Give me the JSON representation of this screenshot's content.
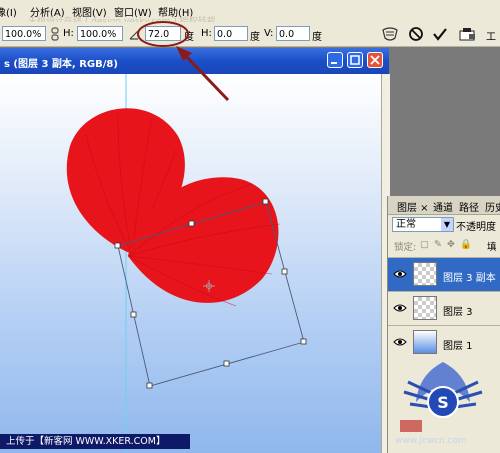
{
  "menubar": {
    "items": [
      "像(I)",
      "分析(A)",
      "视图(V)",
      "窗口(W)",
      "帮助(H)"
    ],
    "watermark": "天极设计在线 ( design.yesky.com ) 授权转载"
  },
  "options": {
    "w_value": "100.0%",
    "h_label": "H:",
    "h_value": "100.0%",
    "angle_value": "72.0",
    "angle_unit": "度",
    "skew_h_label": "H:",
    "skew_h_value": "0.0",
    "skew_unit_h": "度",
    "skew_v_label": "V:",
    "skew_v_value": "0.0",
    "skew_unit_v": "度",
    "extra_label": "工"
  },
  "document": {
    "title": "s (图层 3 副本, RGB/8)"
  },
  "layers_panel": {
    "tabs": [
      "图层 ×",
      "通道",
      "路径",
      "历史"
    ],
    "blend_mode": "正常",
    "opacity_label": "不透明度",
    "lock_label": "锁定:",
    "fill_label": "填",
    "layers": [
      {
        "name": "图层 3 副本",
        "selected": true,
        "thumb": "checker"
      },
      {
        "name": "图层 3",
        "selected": false,
        "thumb": "checker"
      },
      {
        "name": "图层 1",
        "selected": false,
        "thumb": "gradient"
      }
    ]
  },
  "footer": {
    "upload_text": "上传于【新客网 WWW.XKER.COM】",
    "site_mark": "www.jcwcn.com"
  },
  "colors": {
    "petal": "#e8141c",
    "canvas_top": "#ffffff",
    "canvas_bottom": "#8fb7ec",
    "title_bar": "#1a4fc8",
    "selected_layer": "#316ac5",
    "annotation": "#8b1a1a"
  }
}
